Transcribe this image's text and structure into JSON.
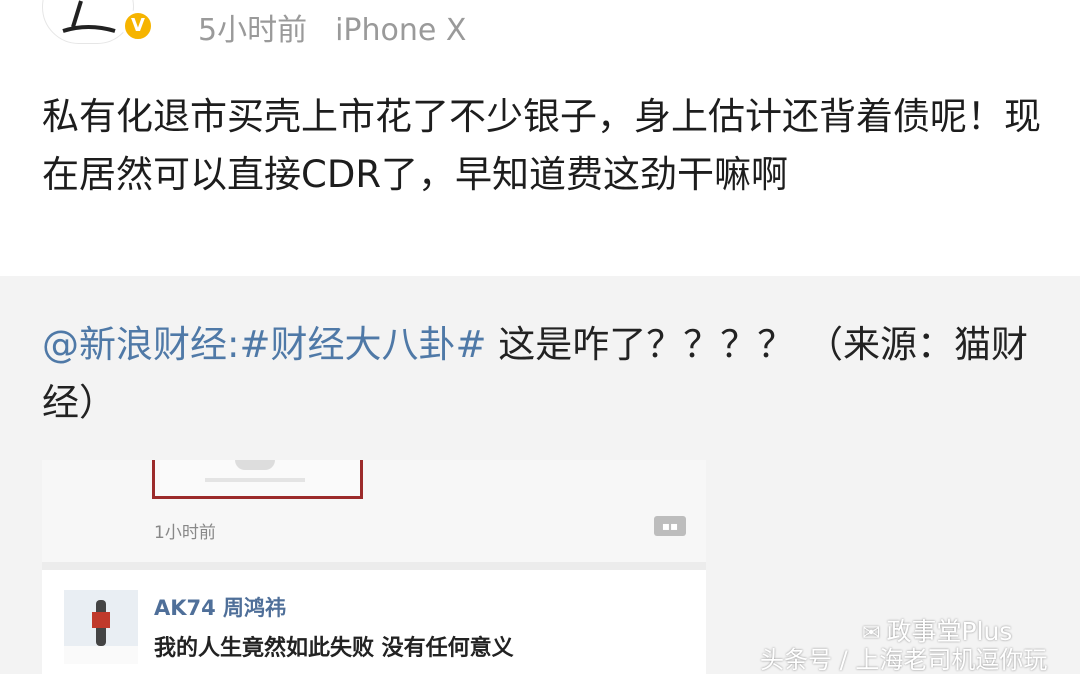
{
  "header": {
    "time": "5小时前",
    "source": "iPhone X",
    "badge": "V"
  },
  "post": {
    "text": "私有化退市买壳上市花了不少银子，身上估计还背着债呢！现在居然可以直接CDR了，早知道费这劲干嘛啊"
  },
  "repost": {
    "mention": "@新浪财经:",
    "topic": "#财经大八卦#",
    "body": "  这是咋了？？？？    （来源：猫财经）",
    "screenshot": {
      "time": "1小时前",
      "comment_icon": "comment-icon",
      "comment": {
        "name": "AK74 周鸿祎",
        "text": "我的人生竟然如此失败 没有任何意义"
      }
    }
  },
  "watermark": {
    "line1": "政事堂Plus",
    "line2": "头条号 / 上海老司机逗你玩",
    "icon": "wechat-icon"
  },
  "colors": {
    "link": "#4f79a7",
    "badge": "#f6b400",
    "meta": "#9a9a9a",
    "repost_bg": "#f3f3f3"
  }
}
